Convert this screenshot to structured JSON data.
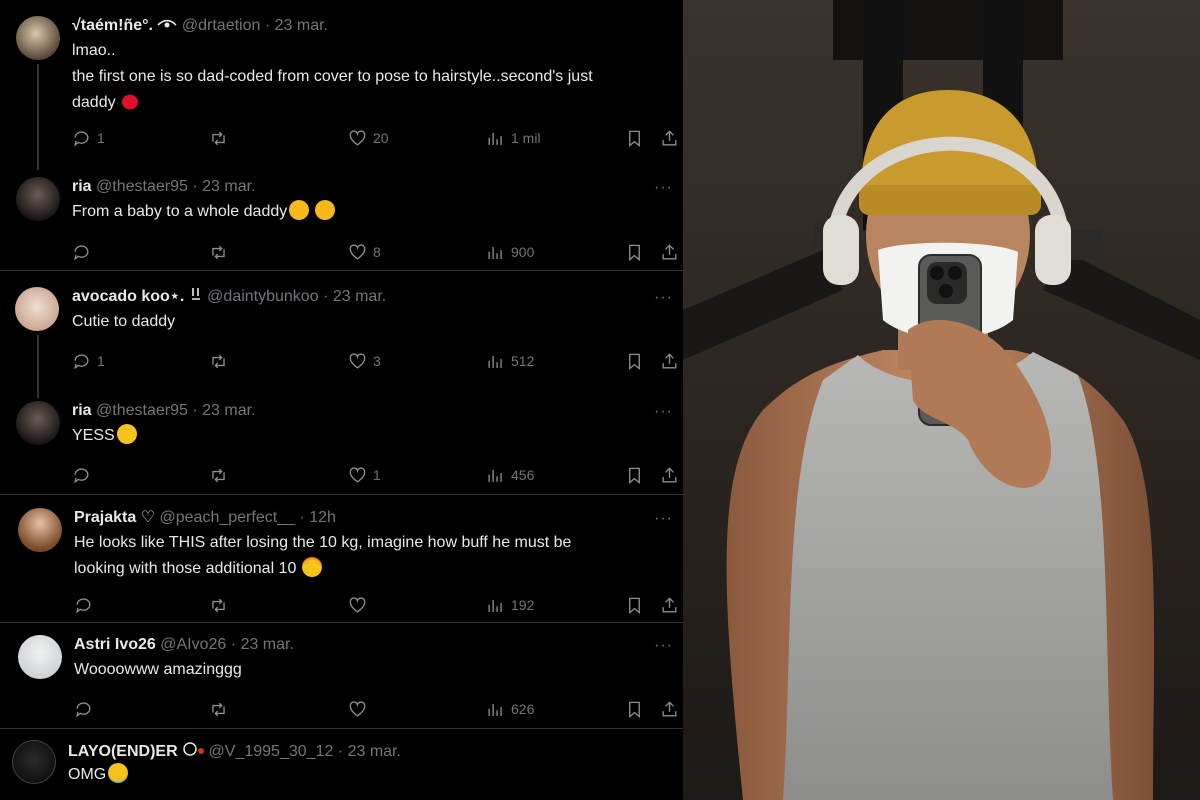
{
  "tweets": [
    {
      "name": "√taém!ñe°.",
      "name_icon": "eye-icon",
      "handle": "@drtaetion",
      "date": "23 mar.",
      "lines": [
        "lmao..",
        "the first one is so dad-coded from cover to pose to hairstyle..second's just",
        "daddy"
      ],
      "emoji": "kiss-lips-emoji",
      "replies": "1",
      "retweets": "",
      "likes": "20",
      "views": "1 mil"
    },
    {
      "name": "ria",
      "handle": "@thestaer95",
      "date": "23 mar.",
      "lines": [
        "From a baby to a whole daddy"
      ],
      "emoji": "salute-and-hug-emoji",
      "replies": "",
      "retweets": "",
      "likes": "8",
      "views": "900"
    },
    {
      "name": "avocado koo⋆.",
      "name_icon": "bunny-icon",
      "handle": "@daintybunkoo",
      "date": "23 mar.",
      "lines": [
        "Cutie to daddy"
      ],
      "replies": "1",
      "retweets": "",
      "likes": "3",
      "views": "512"
    },
    {
      "name": "ria",
      "handle": "@thestaer95",
      "date": "23 mar.",
      "lines": [
        "YESS"
      ],
      "emoji": "teary-face-emoji",
      "replies": "",
      "retweets": "",
      "likes": "1",
      "views": "456"
    },
    {
      "name": "Prajakta ♡",
      "handle": "@peach_perfect__",
      "date": "12h",
      "lines": [
        "He looks like THIS after losing the 10 kg, imagine how buff he must be",
        "looking with those additional 10"
      ],
      "emoji": "exploding-head-emoji",
      "replies": "",
      "retweets": "",
      "likes": "",
      "views": "192"
    },
    {
      "name": "Astri Ivo26",
      "handle": "@AIvo26",
      "date": "23 mar.",
      "lines": [
        "Woooowww amazinggg"
      ],
      "replies": "",
      "retweets": "",
      "likes": "",
      "views": "626"
    },
    {
      "name": "LAYO(END)ER",
      "name_icon": "paw-icon",
      "handle": "@V_1995_30_12",
      "date": "23 mar.",
      "lines": [
        "OMG"
      ],
      "emoji": "crying-face-emoji"
    }
  ],
  "colors": {
    "background": "#000000",
    "text": "#e7e9ea",
    "muted": "#71767b",
    "separator": "#2f3336"
  },
  "photo": {
    "description_icon": "gym-mirror-selfie-photo"
  }
}
